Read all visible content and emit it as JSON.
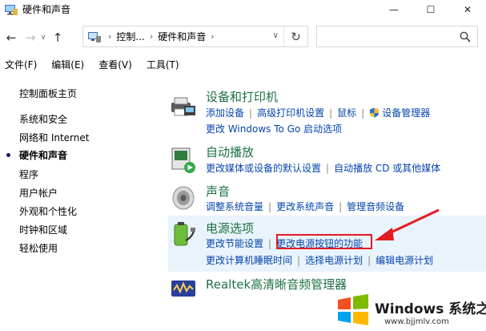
{
  "window": {
    "title": "硬件和声音",
    "minimize": "—",
    "maximize": "☐",
    "close": "✕"
  },
  "address": {
    "crumbs": [
      "控制...",
      "硬件和声音"
    ],
    "search_placeholder": ""
  },
  "menu": [
    "文件(F)",
    "编辑(E)",
    "查看(V)",
    "工具(T)"
  ],
  "sidebar": {
    "items": [
      {
        "label": "控制面板主页",
        "active": false
      },
      {
        "label": "系统和安全",
        "active": false
      },
      {
        "label": "网络和 Internet",
        "active": false
      },
      {
        "label": "硬件和声音",
        "active": true
      },
      {
        "label": "程序",
        "active": false
      },
      {
        "label": "用户帐户",
        "active": false
      },
      {
        "label": "外观和个性化",
        "active": false
      },
      {
        "label": "时钟和区域",
        "active": false
      },
      {
        "label": "轻松使用",
        "active": false
      }
    ]
  },
  "categories": {
    "devices": {
      "title": "设备和打印机",
      "links_row1": [
        "添加设备",
        "高级打印机设置",
        "鼠标",
        "设备管理器"
      ],
      "links_row2": [
        "更改 Windows To Go 启动选项"
      ]
    },
    "autoplay": {
      "title": "自动播放",
      "links_row1": [
        "更改媒体或设备的默认设置",
        "自动播放 CD 或其他媒体"
      ]
    },
    "sound": {
      "title": "声音",
      "links_row1": [
        "调整系统音量",
        "更改系统声音",
        "管理音频设备"
      ]
    },
    "power": {
      "title": "电源选项",
      "links_row1": [
        "更改节能设置",
        "更改电源按钮的功能"
      ],
      "links_row2": [
        "更改计算机睡眠时间",
        "选择电源计划",
        "编辑电源计划"
      ]
    },
    "realtek": {
      "title": "Realtek高清晰音频管理器"
    }
  },
  "watermark": {
    "brand": "Windows 系统之家",
    "url": "www.bjjmlv.com"
  },
  "colors": {
    "link": "#0645ad",
    "category_title": "#1e7145",
    "highlight": "#e9f3fb",
    "annotation_red": "#e31b23"
  }
}
